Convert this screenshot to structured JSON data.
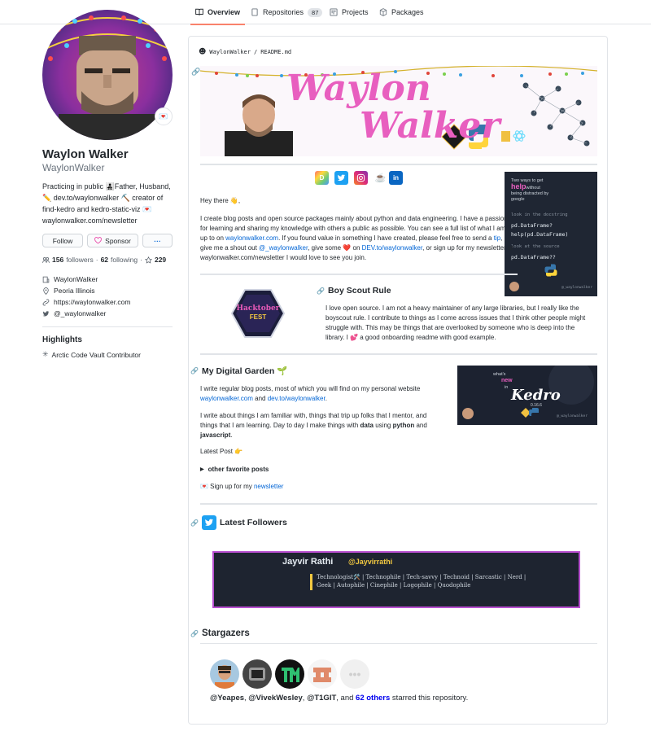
{
  "nav": {
    "tabs": [
      {
        "label": "Overview",
        "icon": "book-icon",
        "active": true
      },
      {
        "label": "Repositories",
        "icon": "repo-icon",
        "count": "87"
      },
      {
        "label": "Projects",
        "icon": "project-icon"
      },
      {
        "label": "Packages",
        "icon": "package-icon"
      }
    ]
  },
  "profile": {
    "status_emoji": "💌",
    "name": "Waylon Walker",
    "login": "WaylonWalker",
    "bio_lines": [
      "Practicing in public 👨‍👧‍👦Father, Husband,",
      "✏️ dev.to/waylonwalker ⛏️ creator of",
      "find-kedro and kedro-static-viz 💌",
      "waylonwalker.com/newsletter"
    ],
    "follow_label": "Follow",
    "sponsor_label": "Sponsor",
    "more_label": "···",
    "followers_count": "156",
    "followers_label": "followers",
    "following_count": "62",
    "following_label": "following",
    "stars_count": "229",
    "company": "WaylonWalker",
    "location": "Peoria Illinois",
    "website": "https://waylonwalker.com",
    "twitter": "@_waylonwalker",
    "highlights_title": "Highlights",
    "highlight": "Arctic Code Vault Contributor"
  },
  "readme": {
    "path_user": "WaylonWalker",
    "path_sep": "/",
    "path_file": "README.md",
    "banner_line1": "Waylon",
    "banner_line2": "Walker",
    "greeting": "Hey there 👋,",
    "intro_1": "I create blog posts and open source packages mainly about python and data engineering. I have a passion",
    "intro_2": "for learning and sharing my knowledge with others a public as possible. You can see a full list of what I am",
    "intro_3a": "up to on ",
    "intro_3_link": "waylonwalker.com",
    "intro_3b": ". If you found value in something I have created, please feel free to send a ",
    "intro_3_tip": "tip",
    "intro_3c": ",",
    "intro_4a": "give me a shout out ",
    "intro_4_link": "@_waylonwalker",
    "intro_4b": ", give some ❤️ on ",
    "intro_4_dev": "DEV.to/waylonwalker",
    "intro_4c": ", or sign up for my newsletter at",
    "intro_5": "waylonwalker.com/newsletter I would love to see you join.",
    "hacktoberfest_1": "Hacktober",
    "hacktoberfest_2": "FEST",
    "scout_title": "Boy Scout Rule",
    "scout_1": "I love open source. I am not a heavy maintainer of any large libraries, but I really like the",
    "scout_2": "boyscout rule. I contribute to things as I come across issues that I think other people might",
    "scout_3": "struggle with. This may be things that are overlooked by someone who is deep into the",
    "scout_4": "library. I 💕 a good onboarding readme with good example.",
    "garden_title": "My Digital Garden 🌱",
    "garden_1": "I write regular blog posts, most of which you will find on my personal website",
    "garden_2_link1": "waylonwalker.com",
    "garden_2_and": " and ",
    "garden_2_link2": "dev.to/waylonwalker",
    "garden_2_end": ".",
    "garden_3": "I write about things I am familiar with, things that trip up folks that I mentor, and",
    "garden_4a": "things that I am learning. Day to day I make things with ",
    "garden_4_data": "data",
    "garden_4b": " using ",
    "garden_4_python": "python",
    "garden_4c": " and",
    "garden_5": "javascript",
    "garden_5b": ".",
    "latest_post": "Latest Post 👉",
    "other_posts": "other favorite posts",
    "newsletter_a": "💌 Sign up for my ",
    "newsletter_link": "newsletter",
    "followers_title": "Latest Followers",
    "follower_name": "Jayvir Rathi",
    "follower_handle": "@Jayvirrathi",
    "follower_bio_1": "Technologist🛠️ | Technophile | Tech-savvy | Technoid | Sarcastic | Nerd |",
    "follower_bio_2": "Geek | Autophile | Cinephile | Logophile | Quodophile",
    "stargazers_title": "Stargazers",
    "star_1": "@Yeapes",
    "star_2": "@VivekWesley",
    "star_3": "@T1GIT",
    "star_and": ", and ",
    "star_others": "62 others",
    "star_end": " starred this repository."
  },
  "cards": {
    "help_1": "Two ways to get",
    "help_2": "help",
    "help_2b": "without",
    "help_3": "being distracted by",
    "help_4": "google",
    "help_code_1": "look in the docstring",
    "help_code_2": "pd.DataFrame?",
    "help_code_3": "help(pd.DataFrame)",
    "help_code_4": "look at the source",
    "help_code_5": "pd.DataFrame??",
    "kedro_1": "what's",
    "kedro_2": "new",
    "kedro_3": "in",
    "kedro_4": "Kedro",
    "kedro_5": "0.16.6",
    "handle_small": "@_waylonwalker"
  },
  "colors": {
    "accent": "#f9826c",
    "link": "#0366d6",
    "pink": "#e85fbf",
    "follower_border": "#b84fd0",
    "follower_bg": "#1e2430"
  }
}
